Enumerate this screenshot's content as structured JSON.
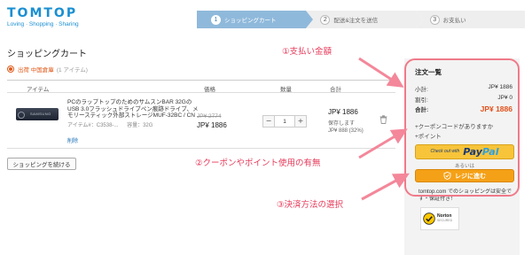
{
  "header": {
    "logo": "TOMTOP",
    "tagline": "Loving · Shopping · Sharing",
    "steps": [
      {
        "num": "1",
        "label": "ショッピングカート"
      },
      {
        "num": "2",
        "label": "配送&注文を送信"
      },
      {
        "num": "3",
        "label": "お支払い"
      }
    ]
  },
  "page_title": "ショッピングカート",
  "warehouse": {
    "label": "出荷 中国倉庫",
    "count": "(1 アイテム)"
  },
  "table": {
    "headers": {
      "item": "アイテム",
      "price": "価格",
      "qty": "数量",
      "total": "合計"
    },
    "row": {
      "title": "PCのラップトップのためのサムスンBAR 32GのUSB 3.0フラッシュドライブペン痕跡ドライブ、メモリースティック外部ストレージMUF-32BC / CN",
      "item_no": "アイテム#：C3538-...",
      "capacity": "容量：32G",
      "delete": "削除",
      "brand": "SAMSUNG",
      "old_price": "JP¥ 2774",
      "price": "JP¥ 1886",
      "quantity": "1",
      "minus": "−",
      "plus": "+",
      "total": "JP¥ 1886",
      "saved_label": "保存します",
      "saved_value": "JP¥ 888 (32%)"
    }
  },
  "continue_button": "ショッピングを続ける",
  "summary": {
    "title": "注文一覧",
    "subtotal_label": "小計:",
    "subtotal_value": "JP¥ 1886",
    "discount_label": "割引:",
    "discount_value": "JP¥ 0",
    "total_label": "合計:",
    "total_value": "JP¥ 1886",
    "coupon_link": "+クーポンコードがありますか",
    "points_link": "+ポイント",
    "paypal_checkout": "Check out with",
    "paypal_word_1": "Pay",
    "paypal_word_2": "Pal",
    "or_text": "あるいは",
    "register_button": "レジに進む",
    "secure_text": "tomtop.com でのショッピングは安全です・保証付き！",
    "norton_label": "Norton",
    "norton_sub": "SECURED"
  },
  "annotations": {
    "a1": "①支払い金額",
    "a2": "②クーポンやポイント使用の有無",
    "a3": "③決済方法の選択"
  },
  "colors": {
    "accent": "#1a8fd1",
    "annotation": "#e63a5a",
    "register": "#f5a117",
    "paypal": "#f7c43a"
  }
}
